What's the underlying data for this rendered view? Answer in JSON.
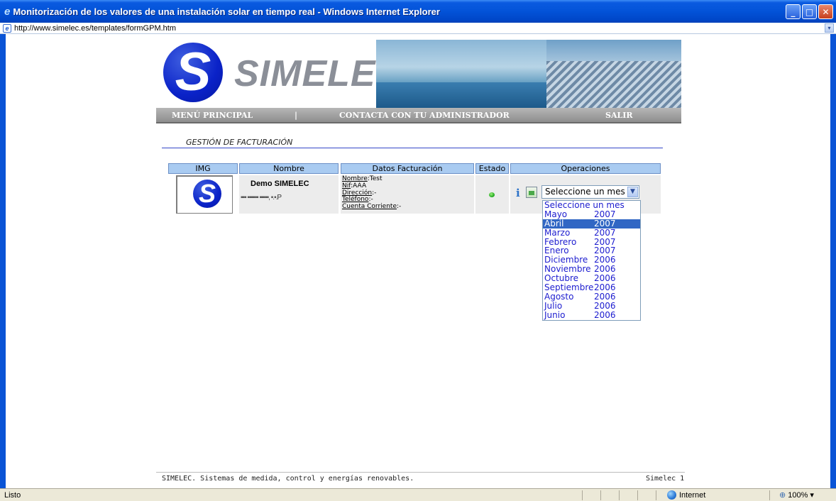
{
  "window": {
    "title": "Monitorización de los valores de una instalación solar en tiempo real - Windows Internet Explorer",
    "address": "http://www.simelec.es/templates/formGPM.htm",
    "ie_glyph": "e",
    "minimize": "_",
    "maximize": "□",
    "close": "✕",
    "addr_dropdown": "▾"
  },
  "banner": {
    "logo_letter": "S",
    "brand": "SIMELEC"
  },
  "menu": {
    "main": "MENÚ PRINCIPAL",
    "separator": "|",
    "contact": "CONTACTA CON TU ADMINISTRADOR",
    "exit": "SALIR"
  },
  "section": {
    "title": "GESTIÓN DE FACTURACIÓN"
  },
  "table": {
    "headers": [
      "IMG",
      "Nombre",
      "Datos Facturación",
      "Estado",
      "Operaciones"
    ],
    "row": {
      "logo_letter": "S",
      "nombre": "Demo SIMELEC",
      "nombre_sub": "P",
      "datos": [
        {
          "key": "Nombre",
          "value": ":Test"
        },
        {
          "key": "Nif",
          "value": ":AAA"
        },
        {
          "key": "Dirección",
          "value": ":-"
        },
        {
          "key": "Teléfono",
          "value": ":-"
        },
        {
          "key": "Cuenta Corriente",
          "value": ":-"
        }
      ],
      "estado_color": "#19a41a",
      "info_glyph": "i",
      "select_value": "Seleccione un mes",
      "select_arrow": "▼"
    }
  },
  "dropdown_options": [
    {
      "month": "Seleccione un mes",
      "year": ""
    },
    {
      "month": "Mayo",
      "year": "2007"
    },
    {
      "month": "Abril",
      "year": "2007",
      "selected": true
    },
    {
      "month": "Marzo",
      "year": "2007"
    },
    {
      "month": "Febrero",
      "year": "2007"
    },
    {
      "month": "Enero",
      "year": "2007"
    },
    {
      "month": "Diciembre",
      "year": "2006"
    },
    {
      "month": "Noviembre",
      "year": "2006"
    },
    {
      "month": "Octubre",
      "year": "2006"
    },
    {
      "month": "Septiembre",
      "year": "2006"
    },
    {
      "month": "Agosto",
      "year": "2006"
    },
    {
      "month": "Julio",
      "year": "2006"
    },
    {
      "month": "Junio",
      "year": "2006"
    }
  ],
  "footer": {
    "left": "SIMELEC. Sistemas de medida, control y energías renovables.",
    "right": "Simelec 1"
  },
  "statusbar": {
    "status": "Listo",
    "zone": "Internet",
    "zoom": "100%",
    "zoom_glyph": "⊕",
    "zoom_arrow": "▾"
  },
  "colors": {
    "titlebar": "#0353d8",
    "header_bg": "#a9cbf1",
    "selected_option": "#3167c4",
    "option_text": "#1c1ccf",
    "section_line": "#3446c8"
  }
}
